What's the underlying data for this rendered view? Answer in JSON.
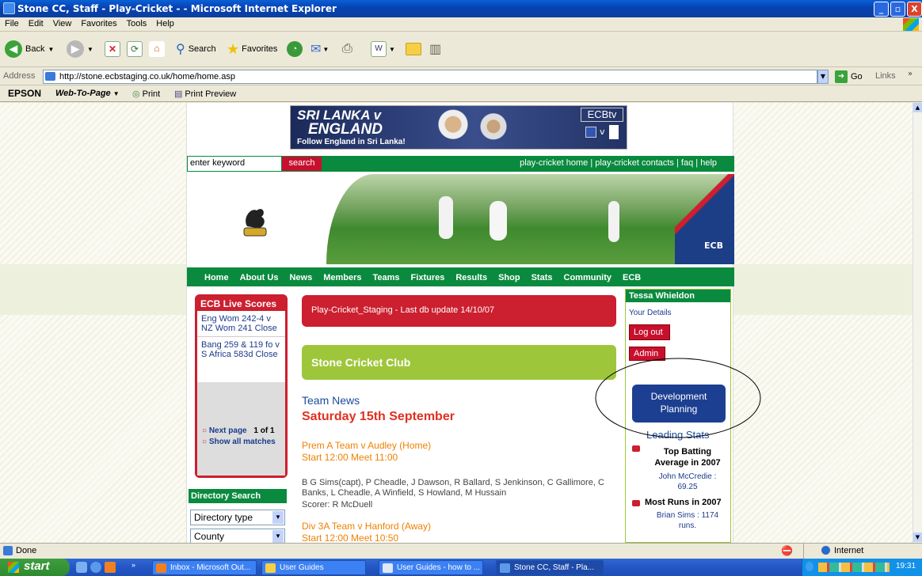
{
  "window": {
    "title": "Stone CC, Staff - Play-Cricket - - Microsoft Internet Explorer",
    "controls": [
      "_",
      "▫",
      "X"
    ]
  },
  "menu": [
    "File",
    "Edit",
    "View",
    "Favorites",
    "Tools",
    "Help"
  ],
  "toolbar": {
    "back": "Back",
    "search": "Search",
    "favorites": "Favorites"
  },
  "address": {
    "label": "Address",
    "url": "http://stone.ecbstaging.co.uk/home/home.asp",
    "go": "Go",
    "links": "Links"
  },
  "links_bar": {
    "brand": "EPSON",
    "web_to_page": "Web-To-Page",
    "print": "Print",
    "print_preview": "Print Preview"
  },
  "banner": {
    "line1": "SRI LANKA v",
    "line2": "ENGLAND",
    "line3": "Follow England in Sri Lanka!",
    "tv": "ECBtv",
    "vs": "v"
  },
  "search": {
    "placeholder": "enter keyword",
    "button": "search",
    "links": [
      "play-cricket home",
      "play-cricket contacts",
      "faq",
      "help"
    ]
  },
  "ecb_logo_text": "ECB",
  "nav": [
    "Home",
    "About Us",
    "News",
    "Members",
    "Teams",
    "Fixtures",
    "Results",
    "Shop",
    "Stats",
    "Community",
    "ECB"
  ],
  "live_scores": {
    "title": "ECB Live Scores",
    "items": [
      "Eng Wom 242-4 v NZ Wom 241 Close",
      "Bang 259 & 119 fo v S Africa 583d Close"
    ],
    "next_page": "Next page",
    "page_info": "1 of 1",
    "show_all": "Show all matches"
  },
  "directory": {
    "title": "Directory Search",
    "type": "Directory type",
    "county": "County"
  },
  "main": {
    "staging": "Play-Cricket_Staging - Last db update 14/10/07",
    "club": "Stone Cricket Club",
    "team_news": "Team News",
    "date": "Saturday 15th September",
    "match1_title": "Prem A Team v Audley (Home)",
    "match1_time": "Start 12:00 Meet 11:00",
    "match1_players": "B G Sims(capt), P Cheadle, J Dawson, R Ballard, S Jenkinson, C Gallimore, C Banks, L Cheadle, A Winfield, S Howland, M Hussain",
    "match1_scorer": "Scorer: R McDuell",
    "match2_title": "Div 3A Team v Hanford (Away)",
    "match2_time": "Start 12:00 Meet 10:50"
  },
  "user": {
    "name": "Tessa Whieldon",
    "details": "Your Details",
    "logout": "Log out",
    "admin": "Admin",
    "dev_line1": "Development",
    "dev_line2": "Planning",
    "leading_stats": "Leading Stats",
    "stat1_title": "Top Batting Average in 2007",
    "stat1_value": "John McCredie : 69.25",
    "stat2_title": "Most Runs in 2007",
    "stat2_value": "Brian Sims : 1174 runs."
  },
  "status": {
    "text": "Done",
    "zone": "Internet"
  },
  "taskbar": {
    "start": "start",
    "tasks": [
      "Inbox - Microsoft Out...",
      "User Guides",
      "User Guides - how to ...",
      "Stone CC, Staff - Pla..."
    ],
    "time": "19:31"
  }
}
